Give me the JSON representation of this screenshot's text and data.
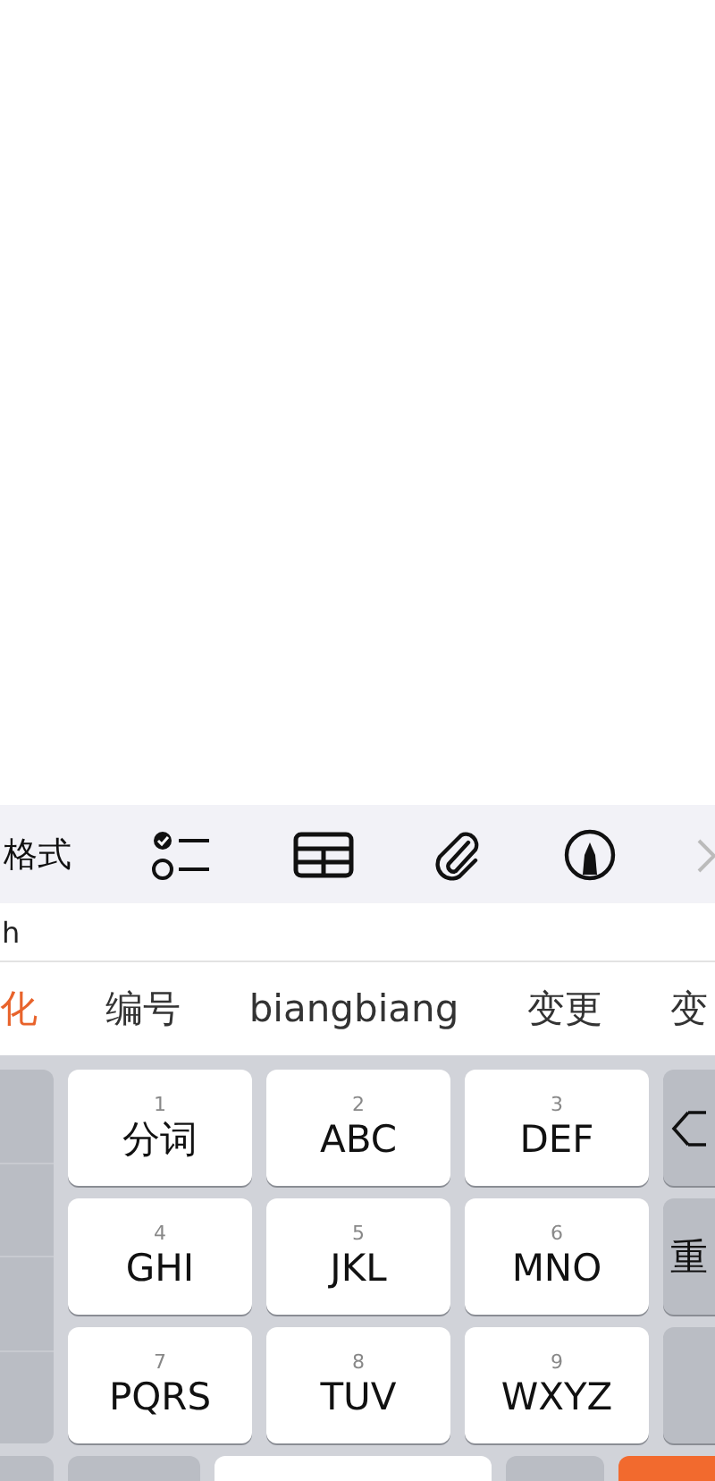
{
  "toolbar": {
    "items": [
      {
        "kind": "text",
        "label": "格式"
      },
      {
        "kind": "checklist"
      },
      {
        "kind": "table"
      },
      {
        "kind": "attachment"
      },
      {
        "kind": "markup"
      },
      {
        "kind": "close"
      }
    ]
  },
  "composition": {
    "text": "h"
  },
  "candidates": [
    {
      "text": "化",
      "selected": true
    },
    {
      "text": "编号",
      "selected": false
    },
    {
      "text": "biangbiang",
      "selected": false
    },
    {
      "text": "变更",
      "selected": false
    },
    {
      "text": "变",
      "selected": false
    }
  ],
  "keyboard": {
    "keys": [
      {
        "digit": "1",
        "label": "分词"
      },
      {
        "digit": "2",
        "label": "ABC"
      },
      {
        "digit": "3",
        "label": "DEF"
      },
      {
        "digit": "4",
        "label": "GHI"
      },
      {
        "digit": "5",
        "label": "JKL"
      },
      {
        "digit": "6",
        "label": "MNO"
      },
      {
        "digit": "7",
        "label": "PQRS"
      },
      {
        "digit": "8",
        "label": "TUV"
      },
      {
        "digit": "9",
        "label": "WXYZ"
      }
    ],
    "right_keys": [
      {
        "kind": "backspace"
      },
      {
        "kind": "text",
        "label": "重"
      },
      {
        "kind": "blank"
      }
    ]
  }
}
